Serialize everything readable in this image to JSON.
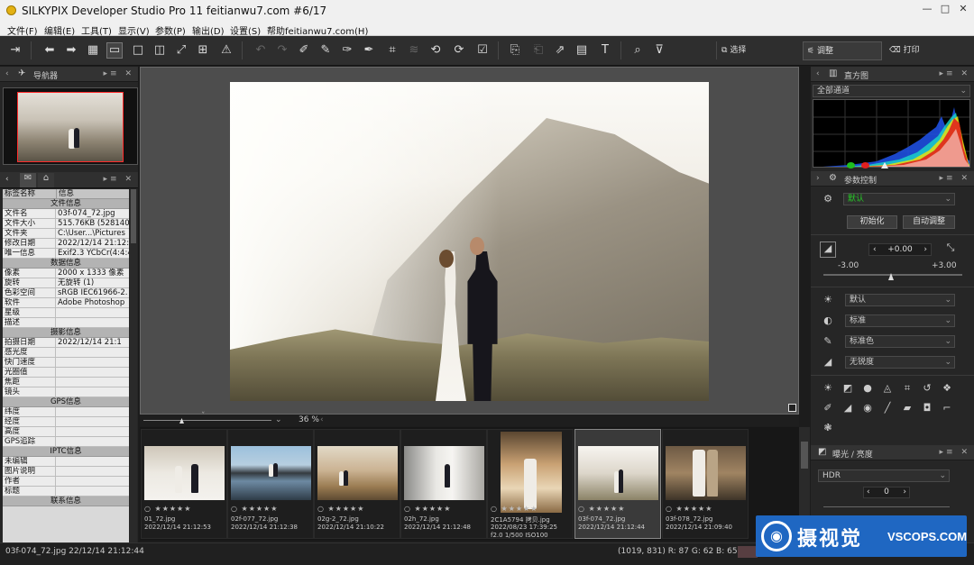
{
  "window": {
    "title": "SILKYPIX Developer Studio Pro 11 feitianwu7.com  #6/17",
    "minimize": "—",
    "maximize": "□",
    "close": "✕"
  },
  "menu": [
    "文件(F)",
    "编辑(E)",
    "工具(T)",
    "显示(V)",
    "参数(P)",
    "输出(D)",
    "设置(S)",
    "帮助feitianwu7.com(H)"
  ],
  "toolbar": {
    "select_label": "选择",
    "adjust_label": "调整",
    "print_label": "打印"
  },
  "navigator": {
    "title": "导航器"
  },
  "info": {
    "col_tag": "标签名称",
    "col_info": "信息",
    "sections": [
      {
        "title": "文件信息",
        "rows": [
          [
            "文件名",
            "03f-074_72.jpg"
          ],
          [
            "文件大小",
            "515.76KB (528140"
          ],
          [
            "文件夹",
            "C:\\User...\\Pictures"
          ],
          [
            "修改日期",
            "2022/12/14 21:12:4"
          ],
          [
            "唯一信息",
            "Exif2.3 YCbCr(4:4:4"
          ]
        ]
      },
      {
        "title": "数据信息",
        "rows": [
          [
            "像素",
            "2000 x 1333 像素"
          ],
          [
            "旋转",
            "无旋转 (1)"
          ],
          [
            "色彩空间",
            "sRGB IEC61966-2."
          ],
          [
            "软件",
            "Adobe Photoshop"
          ],
          [
            "星级",
            ""
          ],
          [
            "描述",
            ""
          ]
        ]
      },
      {
        "title": "摄影信息",
        "rows": [
          [
            "拍摄日期",
            "2022/12/14 21:1"
          ],
          [
            "感光度",
            ""
          ],
          [
            "快门速度",
            ""
          ],
          [
            "光圈值",
            ""
          ],
          [
            "焦距",
            ""
          ],
          [
            "镜头",
            ""
          ]
        ]
      },
      {
        "title": "GPS信息",
        "rows": [
          [
            "纬度",
            ""
          ],
          [
            "经度",
            ""
          ],
          [
            "高度",
            ""
          ],
          [
            "GPS追踪",
            ""
          ]
        ]
      },
      {
        "title": "IPTC信息",
        "rows": [
          [
            "未编辑",
            ""
          ],
          [
            "图片说明",
            ""
          ],
          [
            "作者",
            ""
          ],
          [
            "标题",
            ""
          ]
        ]
      },
      {
        "title": "联系信息",
        "rows": []
      }
    ]
  },
  "viewer": {
    "zoom": "36 %"
  },
  "filmstrip": [
    {
      "name": "01_72.jpg",
      "date": "2022/12/14 21:12:53",
      "extra": "",
      "stars": "○ ★★★★★"
    },
    {
      "name": "02f-077_72.jpg",
      "date": "2022/12/14 21:12:38",
      "extra": "",
      "stars": "○ ★★★★★"
    },
    {
      "name": "02g-2_72.jpg",
      "date": "2022/12/14 21:10:22",
      "extra": "",
      "stars": "○ ★★★★★"
    },
    {
      "name": "02h_72.jpg",
      "date": "2022/12/14 21:12:48",
      "extra": "",
      "stars": "○ ★★★★★"
    },
    {
      "name": "2C1A5794 拷贝.jpg",
      "date": "2022/08/23 17:39:25",
      "extra": "f2.0 1/500 ISO100",
      "stars": "○ ★★★★★"
    },
    {
      "name": "03f-074_72.jpg",
      "date": "2022/12/14 21:12:44",
      "extra": "",
      "stars": "○ ★★★★★"
    },
    {
      "name": "03f-078_72.jpg",
      "date": "2022/12/14 21:09:40",
      "extra": "",
      "stars": "○ ★★★★★"
    }
  ],
  "histogram": {
    "title": "直方图",
    "channel": "全部通道"
  },
  "params": {
    "title": "参数控制",
    "preset": "默认",
    "init_button": "初始化",
    "auto_button": "自动调整",
    "exposure_value": "+0.00",
    "exposure_min": "-3.00",
    "exposure_max": "+3.00",
    "wb": "默认",
    "tone": "标准",
    "color": "标准色",
    "sharp": "无锐度"
  },
  "exposure_panel": {
    "title": "曝光 / 亮度",
    "mode": "HDR",
    "value": "0"
  },
  "status": {
    "left": "03f-074_72.jpg 22/12/14 21:12:44",
    "pixel": "(1019, 831)  R: 87  G: 62  B: 65"
  },
  "watermark": {
    "cn": "摄视觉",
    "en": "VSCOPS.COM"
  }
}
